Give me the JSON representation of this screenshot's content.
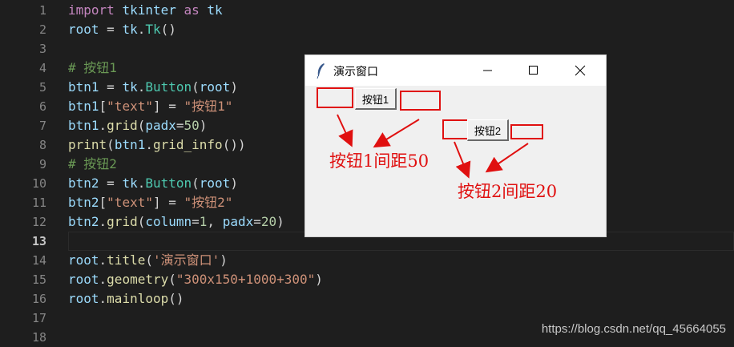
{
  "editor": {
    "current_line": 13,
    "lines": [
      {
        "num": "1",
        "tokens": [
          {
            "t": "import",
            "c": "kw"
          },
          {
            "t": " ",
            "c": "op"
          },
          {
            "t": "tkinter",
            "c": "var"
          },
          {
            "t": " as ",
            "c": "kw"
          },
          {
            "t": "tk",
            "c": "var"
          }
        ]
      },
      {
        "num": "2",
        "tokens": [
          {
            "t": "root",
            "c": "var"
          },
          {
            "t": " = ",
            "c": "op"
          },
          {
            "t": "tk",
            "c": "var"
          },
          {
            "t": ".",
            "c": "op"
          },
          {
            "t": "Tk",
            "c": "cls"
          },
          {
            "t": "()",
            "c": "op"
          }
        ]
      },
      {
        "num": "3",
        "tokens": []
      },
      {
        "num": "4",
        "tokens": [
          {
            "t": "# 按钮1",
            "c": "cm"
          }
        ]
      },
      {
        "num": "5",
        "tokens": [
          {
            "t": "btn1",
            "c": "var"
          },
          {
            "t": " = ",
            "c": "op"
          },
          {
            "t": "tk",
            "c": "var"
          },
          {
            "t": ".",
            "c": "op"
          },
          {
            "t": "Button",
            "c": "cls"
          },
          {
            "t": "(",
            "c": "op"
          },
          {
            "t": "root",
            "c": "var"
          },
          {
            "t": ")",
            "c": "op"
          }
        ]
      },
      {
        "num": "6",
        "tokens": [
          {
            "t": "btn1",
            "c": "var"
          },
          {
            "t": "[",
            "c": "op"
          },
          {
            "t": "\"text\"",
            "c": "str"
          },
          {
            "t": "] = ",
            "c": "op"
          },
          {
            "t": "\"按钮1\"",
            "c": "str"
          }
        ]
      },
      {
        "num": "7",
        "tokens": [
          {
            "t": "btn1",
            "c": "var"
          },
          {
            "t": ".",
            "c": "op"
          },
          {
            "t": "grid",
            "c": "fn"
          },
          {
            "t": "(",
            "c": "op"
          },
          {
            "t": "padx",
            "c": "var"
          },
          {
            "t": "=",
            "c": "op"
          },
          {
            "t": "50",
            "c": "num"
          },
          {
            "t": ")",
            "c": "op"
          }
        ]
      },
      {
        "num": "8",
        "tokens": [
          {
            "t": "print",
            "c": "fn"
          },
          {
            "t": "(",
            "c": "op"
          },
          {
            "t": "btn1",
            "c": "var"
          },
          {
            "t": ".",
            "c": "op"
          },
          {
            "t": "grid_info",
            "c": "fn"
          },
          {
            "t": "())",
            "c": "op"
          }
        ]
      },
      {
        "num": "9",
        "tokens": [
          {
            "t": "# 按钮2",
            "c": "cm"
          }
        ]
      },
      {
        "num": "10",
        "tokens": [
          {
            "t": "btn2",
            "c": "var"
          },
          {
            "t": " = ",
            "c": "op"
          },
          {
            "t": "tk",
            "c": "var"
          },
          {
            "t": ".",
            "c": "op"
          },
          {
            "t": "Button",
            "c": "cls"
          },
          {
            "t": "(",
            "c": "op"
          },
          {
            "t": "root",
            "c": "var"
          },
          {
            "t": ")",
            "c": "op"
          }
        ]
      },
      {
        "num": "11",
        "tokens": [
          {
            "t": "btn2",
            "c": "var"
          },
          {
            "t": "[",
            "c": "op"
          },
          {
            "t": "\"text\"",
            "c": "str"
          },
          {
            "t": "] = ",
            "c": "op"
          },
          {
            "t": "\"按钮2\"",
            "c": "str"
          }
        ]
      },
      {
        "num": "12",
        "tokens": [
          {
            "t": "btn2",
            "c": "var"
          },
          {
            "t": ".",
            "c": "op"
          },
          {
            "t": "grid",
            "c": "fn"
          },
          {
            "t": "(",
            "c": "op"
          },
          {
            "t": "column",
            "c": "var"
          },
          {
            "t": "=",
            "c": "op"
          },
          {
            "t": "1",
            "c": "num"
          },
          {
            "t": ", ",
            "c": "op"
          },
          {
            "t": "padx",
            "c": "var"
          },
          {
            "t": "=",
            "c": "op"
          },
          {
            "t": "20",
            "c": "num"
          },
          {
            "t": ")",
            "c": "op"
          }
        ]
      },
      {
        "num": "13",
        "tokens": []
      },
      {
        "num": "14",
        "tokens": [
          {
            "t": "root",
            "c": "var"
          },
          {
            "t": ".",
            "c": "op"
          },
          {
            "t": "title",
            "c": "fn"
          },
          {
            "t": "(",
            "c": "op"
          },
          {
            "t": "'演示窗口'",
            "c": "str"
          },
          {
            "t": ")",
            "c": "op"
          }
        ]
      },
      {
        "num": "15",
        "tokens": [
          {
            "t": "root",
            "c": "var"
          },
          {
            "t": ".",
            "c": "op"
          },
          {
            "t": "geometry",
            "c": "fn"
          },
          {
            "t": "(",
            "c": "op"
          },
          {
            "t": "\"300x150+1000+300\"",
            "c": "str"
          },
          {
            "t": ")",
            "c": "op"
          }
        ]
      },
      {
        "num": "16",
        "tokens": [
          {
            "t": "root",
            "c": "var"
          },
          {
            "t": ".",
            "c": "op"
          },
          {
            "t": "mainloop",
            "c": "fn"
          },
          {
            "t": "()",
            "c": "op"
          }
        ]
      },
      {
        "num": "17",
        "tokens": []
      },
      {
        "num": "18",
        "tokens": []
      }
    ]
  },
  "colors": {
    "editor_bg": "#1e1e1e",
    "keyword": "#c586c0",
    "variable": "#9cdcfe",
    "class": "#4ec9b0",
    "function": "#dcdcaa",
    "string": "#ce9178",
    "number": "#b5cea8",
    "comment": "#6a9955",
    "annotation_red": "#e01010"
  },
  "tk_window": {
    "title": "演示窗口",
    "icon": "feather-icon",
    "controls": {
      "minimize": "minimize-icon",
      "maximize": "maximize-icon",
      "close": "close-icon"
    },
    "button1_label": "按钮1",
    "button2_label": "按钮2"
  },
  "annotations": {
    "label1": "按钮1间距50",
    "label2": "按钮2间距20"
  },
  "watermark": "https://blog.csdn.net/qq_45664055"
}
